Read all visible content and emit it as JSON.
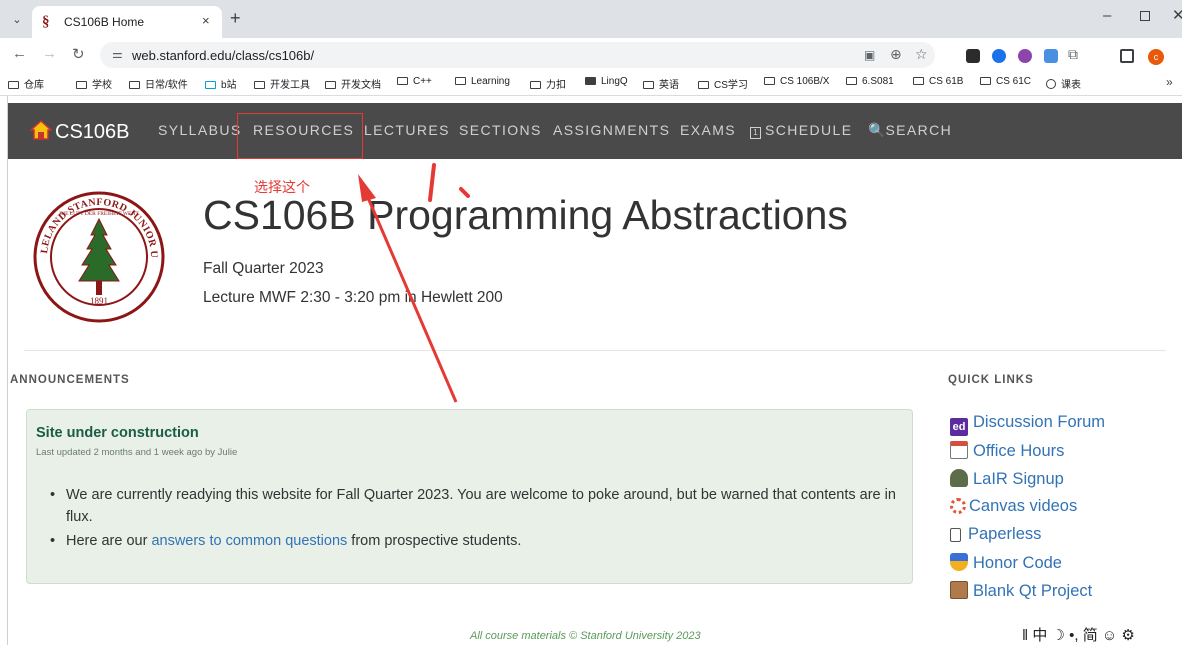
{
  "browser": {
    "tab_title": "CS106B Home",
    "favicon": "§",
    "tab_close": "×",
    "new_tab": "+",
    "url": "web.stanford.edu/class/cs106b/",
    "profile_initial": "c",
    "bookmarks": [
      "仓库",
      "学校",
      "日常/软件",
      "b站",
      "开发工具",
      "开发文档",
      "C++",
      "Learning",
      "力扣",
      "LingQ",
      "英语",
      "CS学习",
      "CS 106B/X",
      "6.S081",
      "CS 61B",
      "CS 61C",
      "课表"
    ],
    "bookmarks_more": "»"
  },
  "site": {
    "brand": "CS106B",
    "nav": [
      "SYLLABUS",
      "RESOURCES",
      "LECTURES",
      "SECTIONS",
      "ASSIGNMENTS",
      "EXAMS",
      "SCHEDULE",
      "SEARCH"
    ],
    "seal_text": "LELAND STANFORD JUNIOR UNIVERSITY",
    "seal_motto": "DIE LUFT DER FREIHEIT WEHT",
    "seal_year": "1891",
    "title": "CS106B Programming Abstractions",
    "subtitle": "Fall Quarter 2023",
    "lecture": "Lecture MWF 2:30 - 3:20 pm in Hewlett 200",
    "announcements_heading": "ANNOUNCEMENTS",
    "quick_links_heading": "QUICK LINKS",
    "announcement": {
      "title": "Site under construction",
      "meta": "Last updated 2 months and 1 week ago by Julie",
      "item1": "We are currently readying this website for Fall Quarter 2023. You are welcome to poke around, but be warned that contents are in flux.",
      "item2_before": "Here are our ",
      "item2_link": "answers to common questions",
      "item2_after": " from prospective students."
    },
    "quick_links": [
      {
        "label": "Discussion Forum",
        "icon": "ed-icon",
        "glyph": "ed"
      },
      {
        "label": "Office Hours",
        "icon": "calendar-icon",
        "glyph": ""
      },
      {
        "label": "LaIR Signup",
        "icon": "detective-icon",
        "glyph": ""
      },
      {
        "label": "Canvas videos",
        "icon": "canvas-icon",
        "glyph": ""
      },
      {
        "label": "Paperless",
        "icon": "paperless-icon",
        "glyph": ""
      },
      {
        "label": "Honor Code",
        "icon": "medal-icon",
        "glyph": ""
      },
      {
        "label": "Blank Qt Project",
        "icon": "box-icon",
        "glyph": ""
      }
    ],
    "footer": "All course materials © Stanford University 2023"
  },
  "annotation": {
    "text": "选择这个",
    "color": "#e53935"
  },
  "ime_bar": "‖ 中 ☽ •, 简 ☺ ⚙",
  "colors": {
    "nav_bg": "#4a4a4a",
    "link": "#3273b5",
    "announcement_bg": "#e8f0e8",
    "announcement_title": "#1a5c45",
    "stanford_red": "#8c1515"
  }
}
